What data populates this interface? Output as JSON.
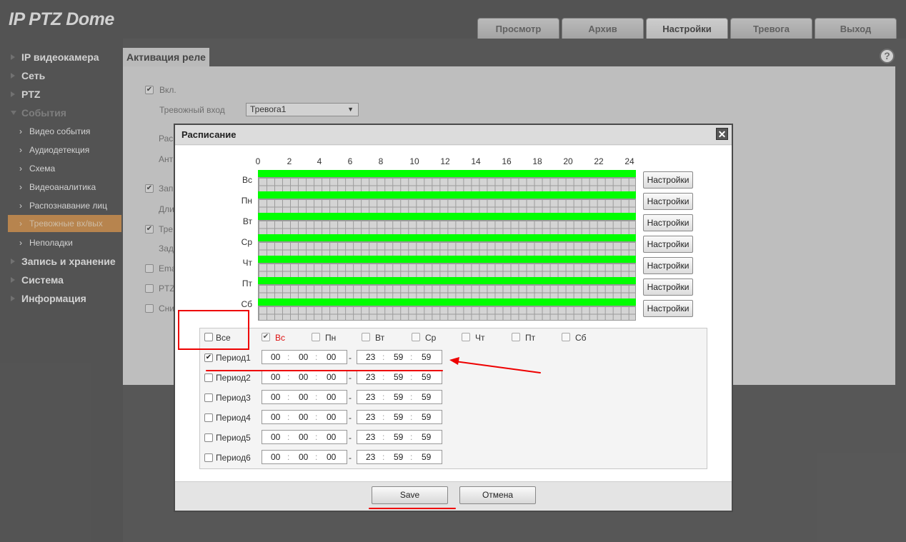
{
  "app": {
    "title": "IP PTZ Dome"
  },
  "tabs": [
    {
      "label": "Просмотр",
      "active": false
    },
    {
      "label": "Архив",
      "active": false
    },
    {
      "label": "Настройки",
      "active": true
    },
    {
      "label": "Тревога",
      "active": false
    },
    {
      "label": "Выход",
      "active": false
    }
  ],
  "sidebar": {
    "top": [
      {
        "label": "IP видеокамера"
      },
      {
        "label": "Сеть"
      },
      {
        "label": "PTZ"
      },
      {
        "label": "События",
        "expanded": true
      }
    ],
    "sub": [
      {
        "label": "Видео события",
        "active": false
      },
      {
        "label": "Аудиодетекция",
        "active": false
      },
      {
        "label": "Схема",
        "active": false
      },
      {
        "label": "Видеоаналитика",
        "active": false
      },
      {
        "label": "Распознавание лиц",
        "active": false
      },
      {
        "label": "Тревожные вх/вых",
        "active": true
      },
      {
        "label": "Неполадки",
        "active": false
      }
    ],
    "bottom": [
      {
        "label": "Запись и хранение"
      },
      {
        "label": "Система"
      },
      {
        "label": "Информация"
      }
    ]
  },
  "content": {
    "tab_label": "Активация реле",
    "help_label": "?",
    "enable_label": "Вкл.",
    "alarm_input_label": "Тревожный вход",
    "alarm_input_value": "Тревога1",
    "arrow": "▼",
    "partial_labels": [
      "Рас",
      "Ант",
      "Зап",
      "Дли",
      "Тре",
      "Зад",
      "Ema",
      "PTZ",
      "Сни"
    ]
  },
  "modal": {
    "title": "Расписание",
    "close_label": "✕",
    "hours": [
      "0",
      "2",
      "4",
      "6",
      "8",
      "10",
      "12",
      "14",
      "16",
      "18",
      "20",
      "22",
      "24"
    ],
    "days": [
      "Вс",
      "Пн",
      "Вт",
      "Ср",
      "Чт",
      "Пт",
      "Сб"
    ],
    "settings_label": "Настройки",
    "all_label": "Все",
    "day_checks": [
      {
        "label": "Вс",
        "checked": true
      },
      {
        "label": "Пн",
        "checked": false
      },
      {
        "label": "Вт",
        "checked": false
      },
      {
        "label": "Ср",
        "checked": false
      },
      {
        "label": "Чт",
        "checked": false
      },
      {
        "label": "Пт",
        "checked": false
      },
      {
        "label": "Сб",
        "checked": false
      }
    ],
    "periods": [
      {
        "label": "Период1",
        "checked": true,
        "start": [
          "00",
          "00",
          "00"
        ],
        "end": [
          "23",
          "59",
          "59"
        ]
      },
      {
        "label": "Период2",
        "checked": false,
        "start": [
          "00",
          "00",
          "00"
        ],
        "end": [
          "23",
          "59",
          "59"
        ]
      },
      {
        "label": "Период3",
        "checked": false,
        "start": [
          "00",
          "00",
          "00"
        ],
        "end": [
          "23",
          "59",
          "59"
        ]
      },
      {
        "label": "Период4",
        "checked": false,
        "start": [
          "00",
          "00",
          "00"
        ],
        "end": [
          "23",
          "59",
          "59"
        ]
      },
      {
        "label": "Период5",
        "checked": false,
        "start": [
          "00",
          "00",
          "00"
        ],
        "end": [
          "23",
          "59",
          "59"
        ]
      },
      {
        "label": "Период6",
        "checked": false,
        "start": [
          "00",
          "00",
          "00"
        ],
        "end": [
          "23",
          "59",
          "59"
        ]
      }
    ],
    "save_label": "Save",
    "cancel_label": "Отмена"
  },
  "colors": {
    "schedule_bar": "#00ff00",
    "active_nav": "#e0a260",
    "annotation": "#ee0000"
  }
}
